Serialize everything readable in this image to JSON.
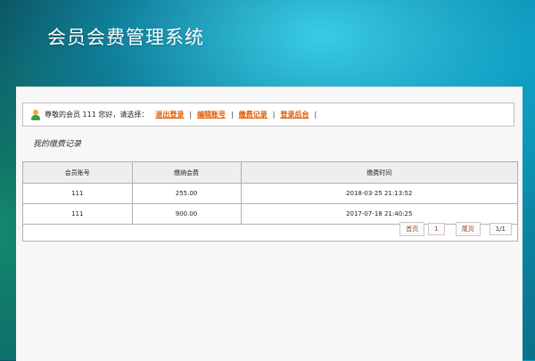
{
  "app": {
    "title": "会员会费管理系统"
  },
  "userbar": {
    "greeting": "尊敬的会员 111 您好，请选择：",
    "links": [
      "退出登录",
      "编辑账号",
      "缴费记录",
      "登录后台"
    ],
    "separator": "|"
  },
  "section": {
    "title": "我的缴费记录"
  },
  "table": {
    "headers": [
      "会员账号",
      "缴纳会费",
      "缴费时间"
    ],
    "rows": [
      [
        "111",
        "255.00",
        "2018-03-25 21:13:52"
      ],
      [
        "111",
        "900.00",
        "2017-07-18 21:40:25"
      ]
    ]
  },
  "pager": {
    "first": "首页",
    "page": "1",
    "last": "尾页",
    "count": "1/1"
  },
  "colors": {
    "link": "#e05a00",
    "accent": "#0aa0c0"
  },
  "icons": {
    "user": "user-icon"
  }
}
